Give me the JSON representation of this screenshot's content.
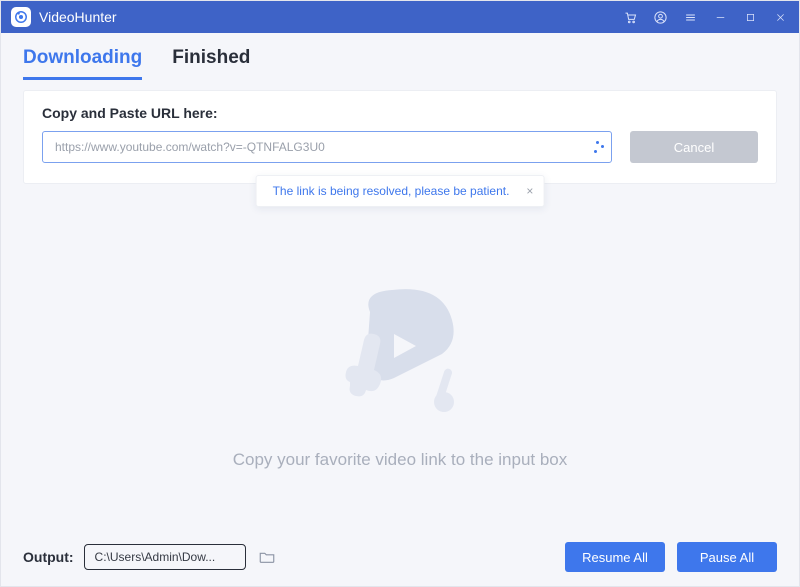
{
  "titlebar": {
    "app_name": "VideoHunter"
  },
  "tabs": {
    "downloading": "Downloading",
    "finished": "Finished",
    "active": "downloading"
  },
  "url_panel": {
    "label": "Copy and Paste URL here:",
    "value": "https://www.youtube.com/watch?v=-QTNFALG3U0",
    "cancel_label": "Cancel"
  },
  "toast": {
    "message": "The link is being resolved, please be patient."
  },
  "empty": {
    "hint": "Copy your favorite video link to the input box"
  },
  "footer": {
    "output_label": "Output:",
    "output_path": "C:\\Users\\Admin\\Dow...",
    "resume_label": "Resume All",
    "pause_label": "Pause All"
  }
}
